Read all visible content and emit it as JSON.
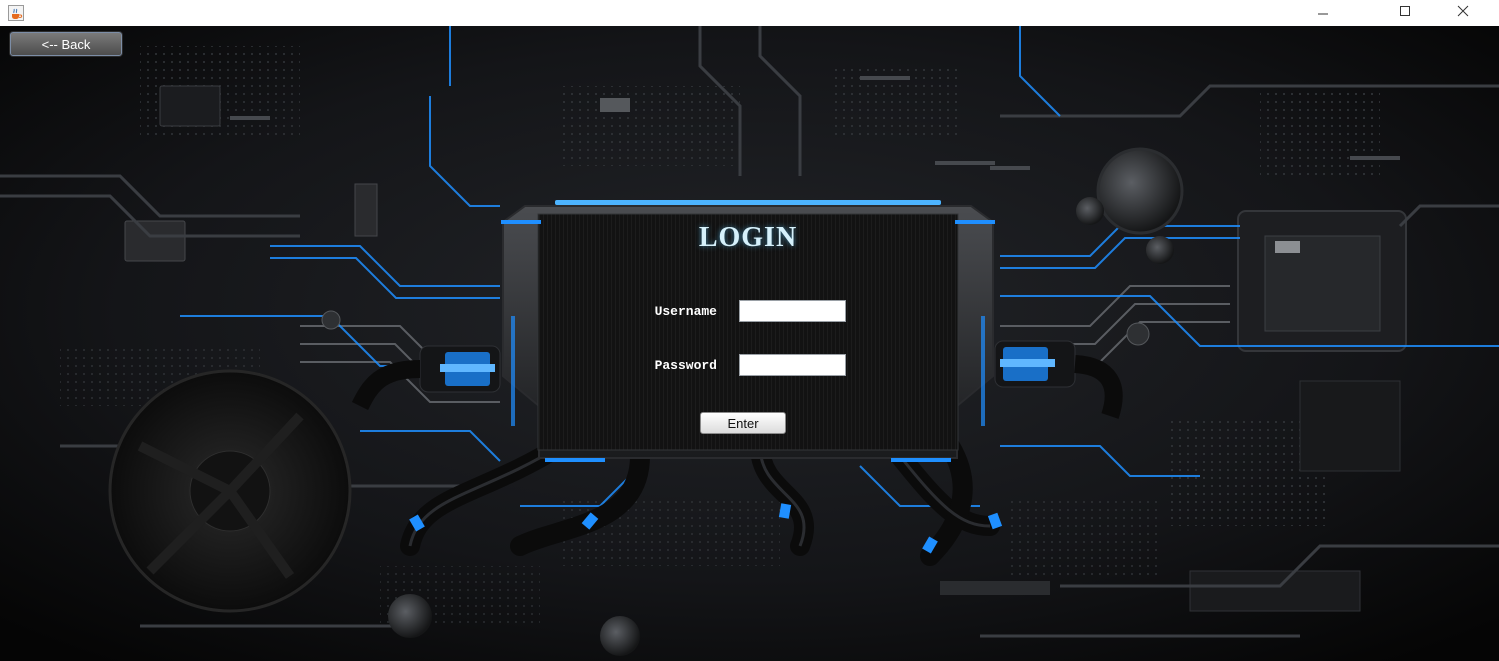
{
  "window": {
    "icon": "java-cup-icon",
    "controls": [
      "minimize-icon",
      "maximize-icon",
      "close-icon"
    ]
  },
  "navigation": {
    "back_label": "<-- Back"
  },
  "login": {
    "title": "LOGIN",
    "username_label": "Username",
    "username_value": "",
    "password_label": "Password",
    "password_value": "",
    "enter_label": "Enter"
  },
  "colors": {
    "background": "#0d0d0f",
    "accent_blue": "#1f8fff",
    "title_glow": "#d6f1fb",
    "panel": "#141414"
  }
}
